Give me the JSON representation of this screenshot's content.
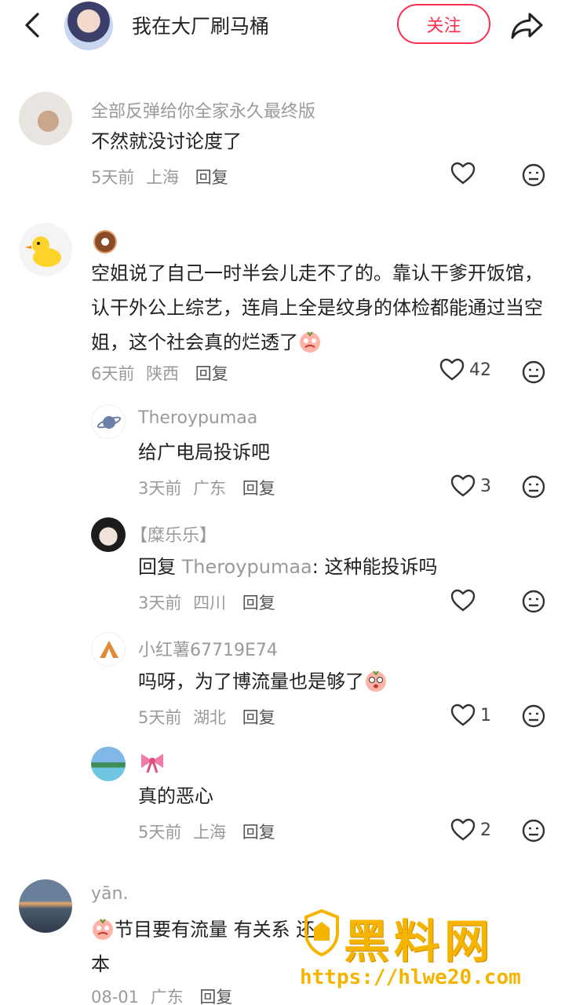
{
  "header": {
    "author": "我在大厂刷马桶",
    "follow_label": "关注"
  },
  "comments": [
    {
      "name": "全部反弹给你全家永久最终版",
      "text": "不然就没讨论度了",
      "time": "5天前",
      "loc": "上海",
      "reply": "回复",
      "likes": ""
    },
    {
      "name": "",
      "text": "空姐说了自己一时半会儿走不了的。靠认干爹开饭馆，认干外公上综艺，连肩上全是纹身的体检都能通过当空姐，这个社会真的烂透了",
      "time": "6天前",
      "loc": "陕西",
      "reply": "回复",
      "likes": "42"
    },
    {
      "name": "Theroypumaa",
      "text": "给广电局投诉吧",
      "time": "3天前",
      "loc": "广东",
      "reply": "回复",
      "likes": "3"
    },
    {
      "name": "【糜乐乐】",
      "reply_prefix": "回复",
      "reply_to": "Theroypumaa",
      "text": ": 这种能投诉吗",
      "time": "3天前",
      "loc": "四川",
      "reply": "回复",
      "likes": ""
    },
    {
      "name": "小红薯67719E74",
      "text": "吗呀，为了博流量也是够了",
      "time": "5天前",
      "loc": "湖北",
      "reply": "回复",
      "likes": "1"
    },
    {
      "name": "",
      "text": "真的恶心",
      "time": "5天前",
      "loc": "上海",
      "reply": "回复",
      "likes": "2"
    },
    {
      "name": "yān.",
      "text": "节目要有流量 有关系 还",
      "text2": "本",
      "time": "08-01",
      "loc": "广东",
      "reply": "回复",
      "likes": ""
    }
  ],
  "watermark": {
    "title": "黑料网",
    "url": "https://hlwe20.com"
  },
  "colors": {
    "accent": "#ff2e4d",
    "meta": "#9a9a9a",
    "watermark": "#f5b400"
  }
}
